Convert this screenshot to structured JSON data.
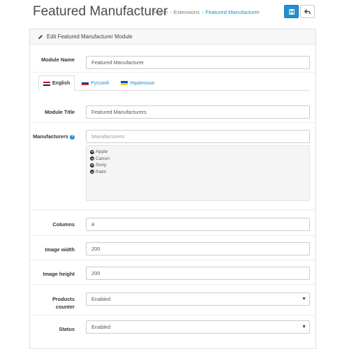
{
  "header": {
    "title": "Featured Manufacturer",
    "breadcrumb": [
      "Home",
      "Extensions",
      "Featured Manufacturer"
    ],
    "save_icon": "floppy-disk-icon",
    "back_icon": "reply-arrow-icon"
  },
  "panel": {
    "heading": "Edit Featured Manufacturer Module",
    "heading_icon": "pencil-icon"
  },
  "form": {
    "module_name_label": "Module Name",
    "module_name_value": "Featured Manufacturer",
    "tabs": [
      {
        "label": "English",
        "flag": "uk-flag-icon",
        "active": true
      },
      {
        "label": "Русский",
        "flag": "ru-flag-icon",
        "active": false
      },
      {
        "label": "Українська",
        "flag": "ua-flag-icon",
        "active": false
      }
    ],
    "module_title_label": "Module Title",
    "module_title_value": "Featured Manufacturers",
    "manufacturers_label": "Manufacturers",
    "manufacturers_placeholder": "Manufacturers",
    "manufacturers": [
      "Apple",
      "Canon",
      "Sony",
      "Palm"
    ],
    "columns_label": "Columns",
    "columns_value": "4",
    "image_width_label": "Image width",
    "image_width_value": "200",
    "image_height_label": "Image height",
    "image_height_value": "200",
    "products_counter_label": "Products counter",
    "products_counter_value": "Enabled",
    "status_label": "Status",
    "status_value": "Enabled"
  },
  "colors": {
    "accent": "#1e91cf",
    "panel_heading_bg": "#f7f7f7",
    "well_bg": "#f5f5f5"
  }
}
